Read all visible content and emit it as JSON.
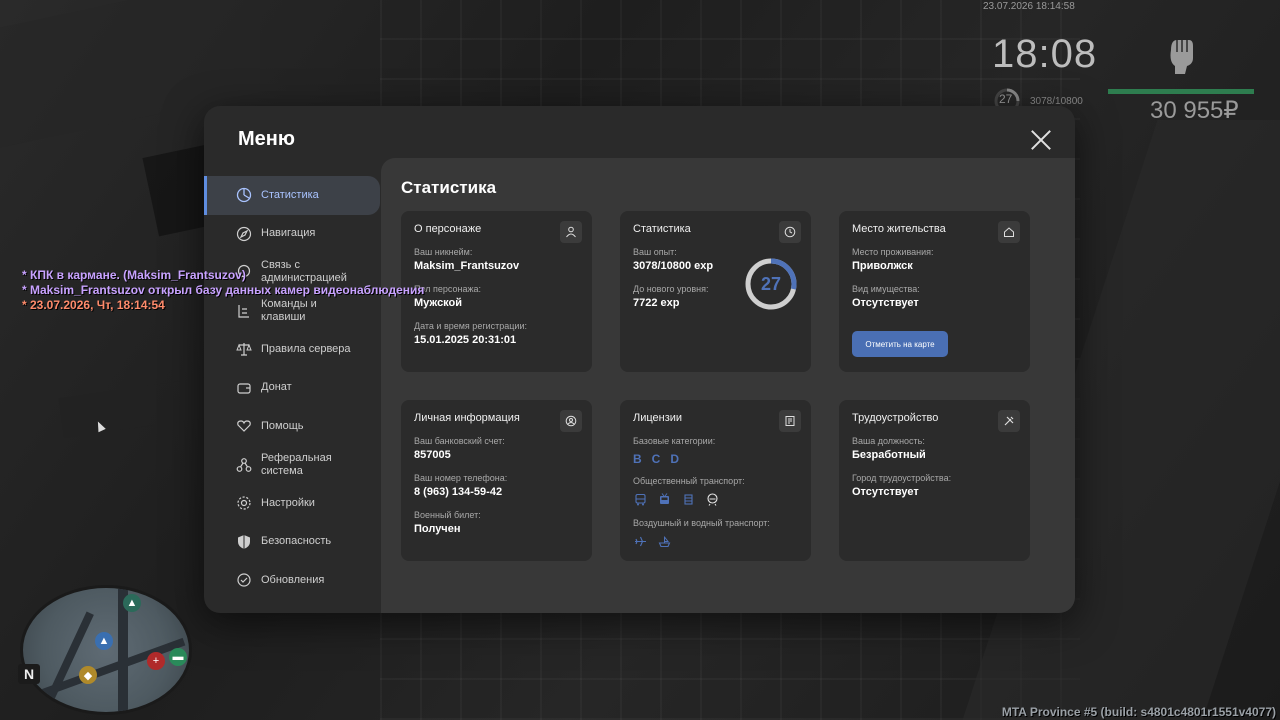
{
  "hud": {
    "datetime": "23.07.2026 18:14:58",
    "clock": "18:08",
    "level": "27",
    "exp": "3078/10800",
    "money": "30 955₽",
    "health_color": "#2e7d4f"
  },
  "chat": [
    "* КПК в кармане. (Maksim_Frantsuzov)",
    "* Maksim_Frantsuzov открыл базу данных камер видеонаблюдения",
    "* 23.07.2026, Чт, 18:14:54"
  ],
  "minimap": {
    "compass": "N"
  },
  "build_info": "MTA Province #5 (build: s4801c4801r1551v4077)",
  "menu": {
    "title": "Меню",
    "sidebar": [
      {
        "label": "Статистика",
        "icon": "pie-chart-icon",
        "active": true
      },
      {
        "label": "Навигация",
        "icon": "compass-icon"
      },
      {
        "label": "Связь с администрацией",
        "icon": "chat-icon"
      },
      {
        "label": "Команды и клавиши",
        "icon": "list-icon"
      },
      {
        "label": "Правила сервера",
        "icon": "scales-icon"
      },
      {
        "label": "Донат",
        "icon": "wallet-icon"
      },
      {
        "label": "Помощь",
        "icon": "heart-hand-icon"
      },
      {
        "label": "Реферальная система",
        "icon": "network-icon"
      },
      {
        "label": "Настройки",
        "icon": "gear-icon"
      },
      {
        "label": "Безопасность",
        "icon": "shield-icon"
      },
      {
        "label": "Обновления",
        "icon": "refresh-icon"
      }
    ],
    "content_title": "Статистика",
    "cards": {
      "character": {
        "title": "О персонаже",
        "nickname_label": "Ваш никнейм:",
        "nickname": "Maksim_Frantsuzov",
        "gender_label": "Пол персонажа:",
        "gender": "Мужской",
        "reg_label": "Дата и время регистрации:",
        "reg": "15.01.2025 20:31:01"
      },
      "stats": {
        "title": "Статистика",
        "exp_label": "Ваш опыт:",
        "exp": "3078/10800 exp",
        "next_label": "До нового уровня:",
        "next": "7722 exp",
        "level": "27",
        "progress": 0.285,
        "accent": "#4f72b8"
      },
      "residence": {
        "title": "Место жительства",
        "place_label": "Место проживания:",
        "place": "Приволжск",
        "property_label": "Вид имущества:",
        "property": "Отсутствует",
        "button": "Отметить на карте"
      },
      "personal": {
        "title": "Личная информация",
        "bank_label": "Ваш банковский счет:",
        "bank": "857005",
        "phone_label": "Ваш номер телефона:",
        "phone": "8 (963) 134-59-42",
        "military_label": "Военный билет:",
        "military": "Получен"
      },
      "licenses": {
        "title": "Лицензии",
        "base_label": "Базовые категории:",
        "base": [
          "B",
          "C",
          "D"
        ],
        "public_label": "Общественный транспорт:",
        "public_icons": [
          "bus-icon",
          "trolleybus-icon",
          "tram-icon",
          "metro-icon"
        ],
        "air_label": "Воздушный и водный транспорт:",
        "air_icons": [
          "plane-icon",
          "boat-icon"
        ]
      },
      "job": {
        "title": "Трудоустройство",
        "position_label": "Ваша должность:",
        "position": "Безработный",
        "city_label": "Город трудоустройства:",
        "city": "Отсутствует"
      }
    }
  }
}
